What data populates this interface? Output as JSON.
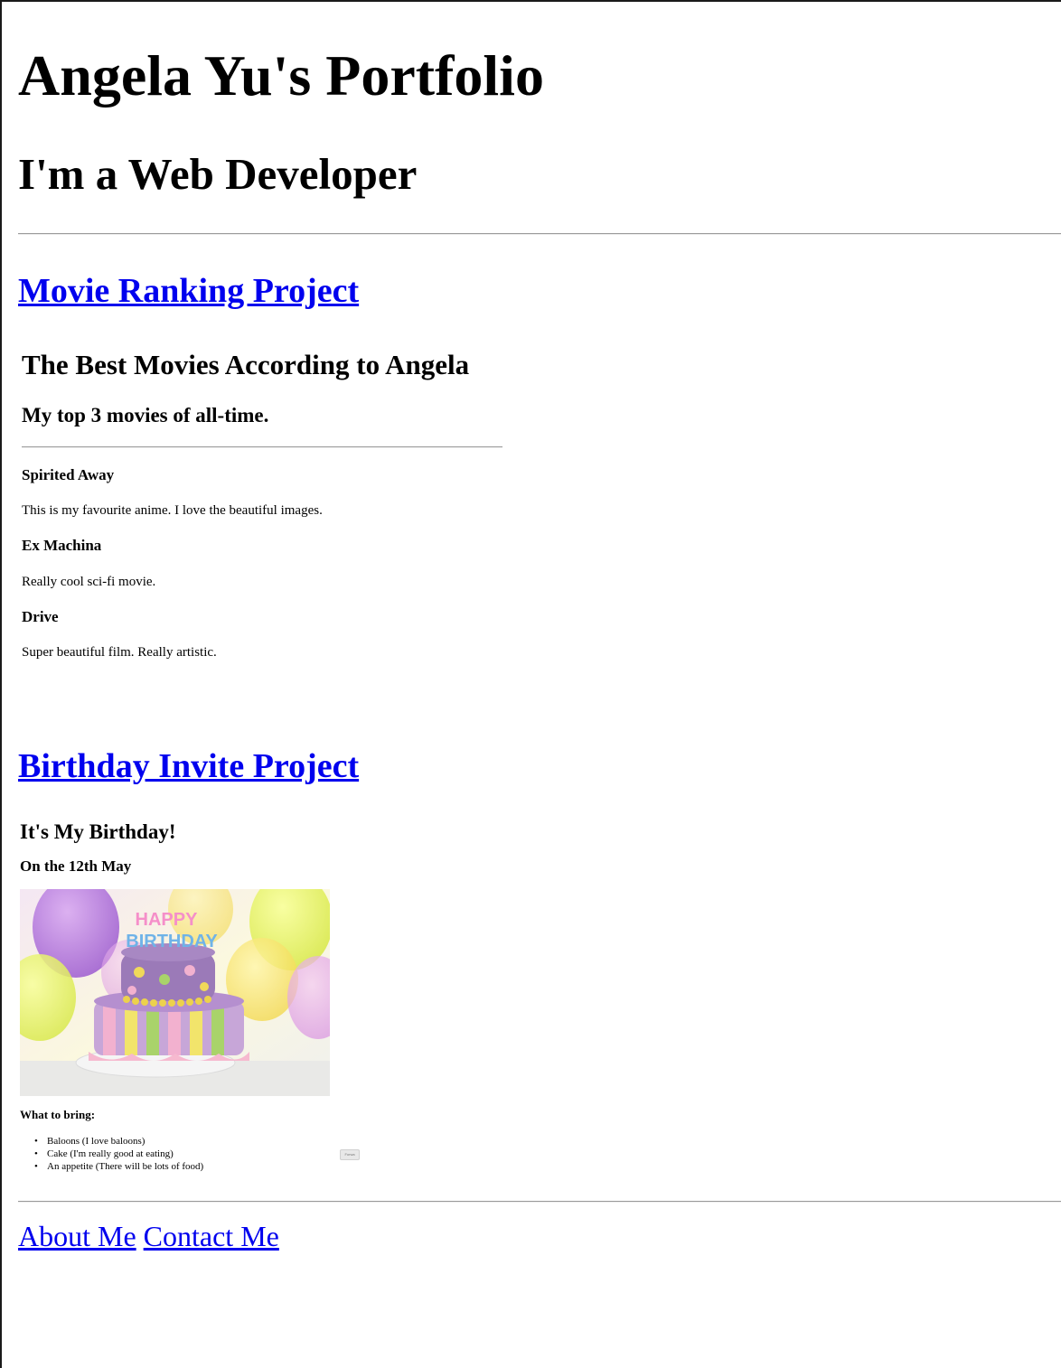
{
  "header": {
    "title": "Angela Yu's Portfolio",
    "subtitle": "I'm a Web Developer"
  },
  "projects": {
    "movie_link": "Movie Ranking Project",
    "birthday_link": "Birthday Invite Project"
  },
  "movie_page": {
    "title": "The Best Movies According to Angela",
    "subtitle": "My top 3 movies of all-time.",
    "movies": [
      {
        "name": "Spirited Away",
        "description": "This is my favourite anime. I love the beautiful images."
      },
      {
        "name": "Ex Machina",
        "description": "Really cool sci-fi movie."
      },
      {
        "name": "Drive",
        "description": "Super beautiful film. Really artistic."
      }
    ]
  },
  "birthday_page": {
    "title": "It's My Birthday!",
    "date": "On the 12th May",
    "cake_text": [
      "HAPPY",
      "BIRTHDAY"
    ],
    "bring_heading": "What to bring:",
    "bring_items": [
      "Baloons (I love baloons)",
      "Cake (I'm really good at eating)",
      "An appetite (There will be lots of food)"
    ],
    "tiny_button": "Forwa"
  },
  "footer": {
    "about_link": "About Me",
    "contact_link": "Contact Me"
  },
  "colors": {
    "link": "#0000ee",
    "text": "#000000",
    "background": "#ffffff"
  }
}
